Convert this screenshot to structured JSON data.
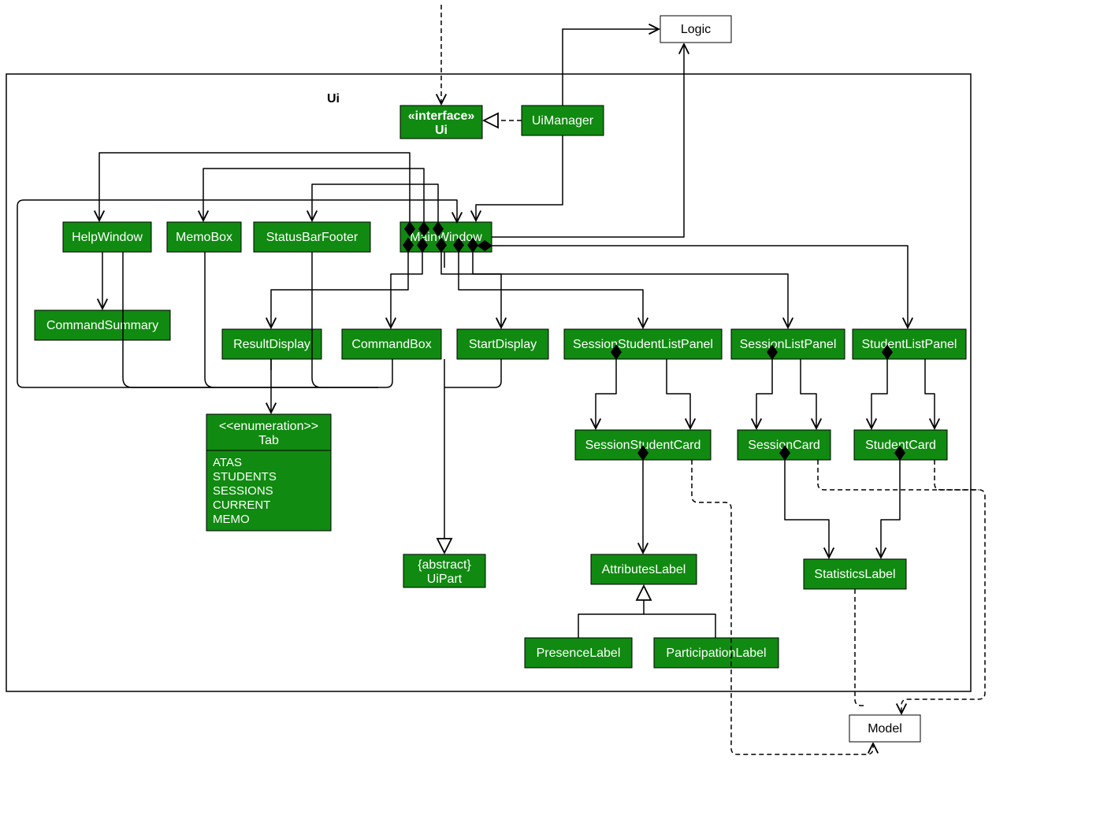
{
  "package": {
    "label": "Ui"
  },
  "external": {
    "logic": "Logic",
    "model": "Model"
  },
  "boxes": {
    "uiInterface": {
      "stereotype": "«interface»",
      "name": "Ui"
    },
    "uiManager": "UiManager",
    "helpWindow": "HelpWindow",
    "memoBox": "MemoBox",
    "statusBarFooter": "StatusBarFooter",
    "mainWindow": "MainWindow",
    "commandSummary": "CommandSummary",
    "resultDisplay": "ResultDisplay",
    "commandBox": "CommandBox",
    "startDisplay": "StartDisplay",
    "sessionStudentListPanel": "SessionStudentListPanel",
    "sessionListPanel": "SessionListPanel",
    "studentListPanel": "StudentListPanel",
    "tabEnum": {
      "stereotype": "<<enumeration>>",
      "name": "Tab",
      "values": [
        "ATAS",
        "STUDENTS",
        "SESSIONS",
        "CURRENT",
        "MEMO"
      ]
    },
    "sessionStudentCard": "SessionStudentCard",
    "sessionCard": "SessionCard",
    "studentCard": "StudentCard",
    "uiPart": {
      "stereotype": "{abstract}",
      "name": "UiPart"
    },
    "attributesLabel": "AttributesLabel",
    "statisticsLabel": "StatisticsLabel",
    "presenceLabel": "PresenceLabel",
    "participationLabel": "ParticipationLabel"
  },
  "edges": [
    {
      "from": "UiManager",
      "to": "Ui",
      "kind": "realization"
    },
    {
      "from": "UiManager",
      "to": "MainWindow",
      "kind": "solid-arrow"
    },
    {
      "from": "external-top",
      "to": "Ui",
      "kind": "dependency"
    },
    {
      "from": "MainWindow",
      "to": "Logic",
      "kind": "solid-arrow"
    },
    {
      "from": "UiManager",
      "to": "Logic",
      "kind": "solid-arrow"
    },
    {
      "from": "MainWindow",
      "to": "HelpWindow",
      "kind": "composition"
    },
    {
      "from": "MainWindow",
      "to": "MemoBox",
      "kind": "composition"
    },
    {
      "from": "MainWindow",
      "to": "StatusBarFooter",
      "kind": "composition"
    },
    {
      "from": "MainWindow",
      "to": "ResultDisplay",
      "kind": "composition"
    },
    {
      "from": "MainWindow",
      "to": "CommandBox",
      "kind": "composition"
    },
    {
      "from": "MainWindow",
      "to": "StartDisplay",
      "kind": "composition"
    },
    {
      "from": "MainWindow",
      "to": "SessionStudentListPanel",
      "kind": "composition"
    },
    {
      "from": "MainWindow",
      "to": "SessionListPanel",
      "kind": "composition"
    },
    {
      "from": "MainWindow",
      "to": "StudentListPanel",
      "kind": "composition"
    },
    {
      "from": "HelpWindow",
      "to": "CommandSummary",
      "kind": "solid-arrow"
    },
    {
      "from": "ResultDisplay",
      "to": "Tab",
      "kind": "solid-arrow"
    },
    {
      "from": "SessionStudentListPanel",
      "to": "SessionStudentCard",
      "kind": "composition"
    },
    {
      "from": "SessionListPanel",
      "to": "SessionCard",
      "kind": "composition"
    },
    {
      "from": "StudentListPanel",
      "to": "StudentCard",
      "kind": "composition"
    },
    {
      "from": "SessionStudentCard",
      "to": "AttributesLabel",
      "kind": "composition"
    },
    {
      "from": "SessionCard",
      "to": "StatisticsLabel",
      "kind": "composition"
    },
    {
      "from": "StudentCard",
      "to": "StatisticsLabel",
      "kind": "composition"
    },
    {
      "from": "PresenceLabel",
      "to": "AttributesLabel",
      "kind": "generalization"
    },
    {
      "from": "ParticipationLabel",
      "to": "AttributesLabel",
      "kind": "generalization"
    },
    {
      "from": "all-UiPart-children",
      "to": "UiPart",
      "kind": "generalization"
    },
    {
      "from": "CommandBox",
      "to": "Logic",
      "kind": "solid-arrow"
    },
    {
      "from": "SessionStudentCard",
      "to": "Model",
      "kind": "dependency"
    },
    {
      "from": "SessionCard",
      "to": "Model",
      "kind": "dependency"
    },
    {
      "from": "StudentCard",
      "to": "Model",
      "kind": "dependency"
    },
    {
      "from": "StatisticsLabel",
      "to": "Model",
      "kind": "dependency"
    },
    {
      "from": "SessionStudentListPanel",
      "to": "Model",
      "kind": "dependency"
    },
    {
      "from": "SessionListPanel",
      "to": "Model",
      "kind": "dependency"
    },
    {
      "from": "StudentListPanel",
      "to": "Model",
      "kind": "dependency"
    }
  ]
}
